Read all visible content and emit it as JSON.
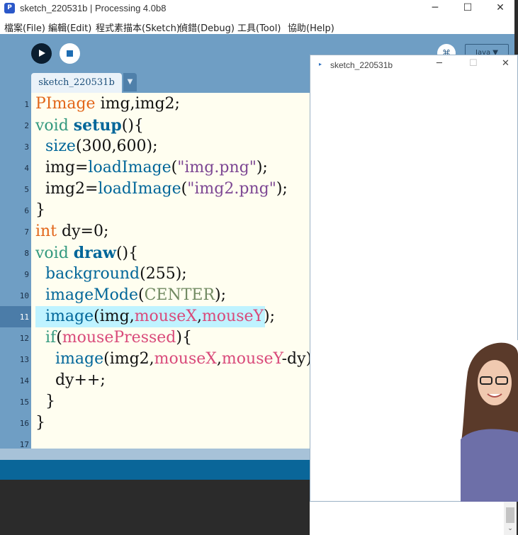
{
  "window": {
    "title": "sketch_220531b | Processing 4.0b8",
    "app_icon": "processing-icon",
    "controls": {
      "minimize": "─",
      "maximize": "☐",
      "close": "✕"
    }
  },
  "menu": {
    "items": [
      "檔案(File)",
      "編輯(Edit)",
      "程式素描本(Sketch)",
      "偵錯(Debug)",
      "工具(Tool)",
      "協助(Help)"
    ]
  },
  "toolbar": {
    "run_icon": "play-icon",
    "stop_icon": "stop-icon",
    "debug_label": "⌘",
    "mode_label": "Java ▼"
  },
  "tab": {
    "label": "sketch_220531b",
    "menu_glyph": "▼"
  },
  "editor": {
    "line_numbers": [
      "1",
      "2",
      "3",
      "4",
      "5",
      "6",
      "7",
      "8",
      "9",
      "10",
      "11",
      "12",
      "13",
      "14",
      "15",
      "16",
      "17"
    ],
    "current_line": "11",
    "colors": {
      "type": "#e2661a",
      "keyword": "#33997e",
      "function": "#006699",
      "string": "#7d4793",
      "builtin_var": "#d94a7a",
      "constant": "#718a62",
      "highlight": "#bff3ff"
    },
    "lines": [
      [
        {
          "c": "k-type",
          "t": "PImage"
        },
        {
          "c": "k-plain",
          "t": " img,img2;"
        }
      ],
      [
        {
          "c": "k-kw",
          "t": "void"
        },
        {
          "c": "k-plain",
          "t": " "
        },
        {
          "c": "k-fnb",
          "t": "setup"
        },
        {
          "c": "k-plain",
          "t": "(){"
        }
      ],
      [
        {
          "c": "k-plain",
          "t": "  "
        },
        {
          "c": "k-fn",
          "t": "size"
        },
        {
          "c": "k-plain",
          "t": "(300,600);"
        }
      ],
      [
        {
          "c": "k-plain",
          "t": "  img="
        },
        {
          "c": "k-fn",
          "t": "loadImage"
        },
        {
          "c": "k-plain",
          "t": "("
        },
        {
          "c": "k-str",
          "t": "\"img.png\""
        },
        {
          "c": "k-plain",
          "t": ");"
        }
      ],
      [
        {
          "c": "k-plain",
          "t": "  img2="
        },
        {
          "c": "k-fn",
          "t": "loadImage"
        },
        {
          "c": "k-plain",
          "t": "("
        },
        {
          "c": "k-str",
          "t": "\"img2.png\""
        },
        {
          "c": "k-plain",
          "t": ");"
        }
      ],
      [
        {
          "c": "k-plain",
          "t": "}"
        }
      ],
      [
        {
          "c": "k-type",
          "t": "int"
        },
        {
          "c": "k-plain",
          "t": " dy=0;"
        }
      ],
      [
        {
          "c": "k-kw",
          "t": "void"
        },
        {
          "c": "k-plain",
          "t": " "
        },
        {
          "c": "k-fnb",
          "t": "draw"
        },
        {
          "c": "k-plain",
          "t": "(){"
        }
      ],
      [
        {
          "c": "k-plain",
          "t": "  "
        },
        {
          "c": "k-fn",
          "t": "background"
        },
        {
          "c": "k-plain",
          "t": "(255);"
        }
      ],
      [
        {
          "c": "k-plain",
          "t": "  "
        },
        {
          "c": "k-fn",
          "t": "imageMode"
        },
        {
          "c": "k-plain",
          "t": "("
        },
        {
          "c": "k-const",
          "t": "CENTER"
        },
        {
          "c": "k-plain",
          "t": ");"
        }
      ],
      [
        {
          "c": "k-plain",
          "t": "  "
        },
        {
          "c": "k-fn",
          "t": "image"
        },
        {
          "c": "k-plain",
          "t": "(img,"
        },
        {
          "c": "k-var",
          "t": "mouseX"
        },
        {
          "c": "k-plain",
          "t": ","
        },
        {
          "c": "k-var",
          "t": "mouseY"
        },
        {
          "c": "k-plain",
          "t": ");"
        }
      ],
      [
        {
          "c": "k-plain",
          "t": "  "
        },
        {
          "c": "k-kw",
          "t": "if"
        },
        {
          "c": "k-plain",
          "t": "("
        },
        {
          "c": "k-var",
          "t": "mousePressed"
        },
        {
          "c": "k-plain",
          "t": "){"
        }
      ],
      [
        {
          "c": "k-plain",
          "t": "    "
        },
        {
          "c": "k-fn",
          "t": "image"
        },
        {
          "c": "k-plain",
          "t": "(img2,"
        },
        {
          "c": "k-var",
          "t": "mouseX"
        },
        {
          "c": "k-plain",
          "t": ","
        },
        {
          "c": "k-var",
          "t": "mouseY"
        },
        {
          "c": "k-plain",
          "t": "-dy)"
        }
      ],
      [
        {
          "c": "k-plain",
          "t": "    dy++;"
        }
      ],
      [
        {
          "c": "k-plain",
          "t": "  }"
        }
      ],
      [
        {
          "c": "k-plain",
          "t": "}"
        }
      ]
    ]
  },
  "sketch_window": {
    "title": "sketch_220531b",
    "icon": "java-app-icon",
    "controls": {
      "minimize": "─",
      "maximize": "☐",
      "close": "✕"
    }
  },
  "scrollbar": {
    "down_arrow": "⌄"
  }
}
